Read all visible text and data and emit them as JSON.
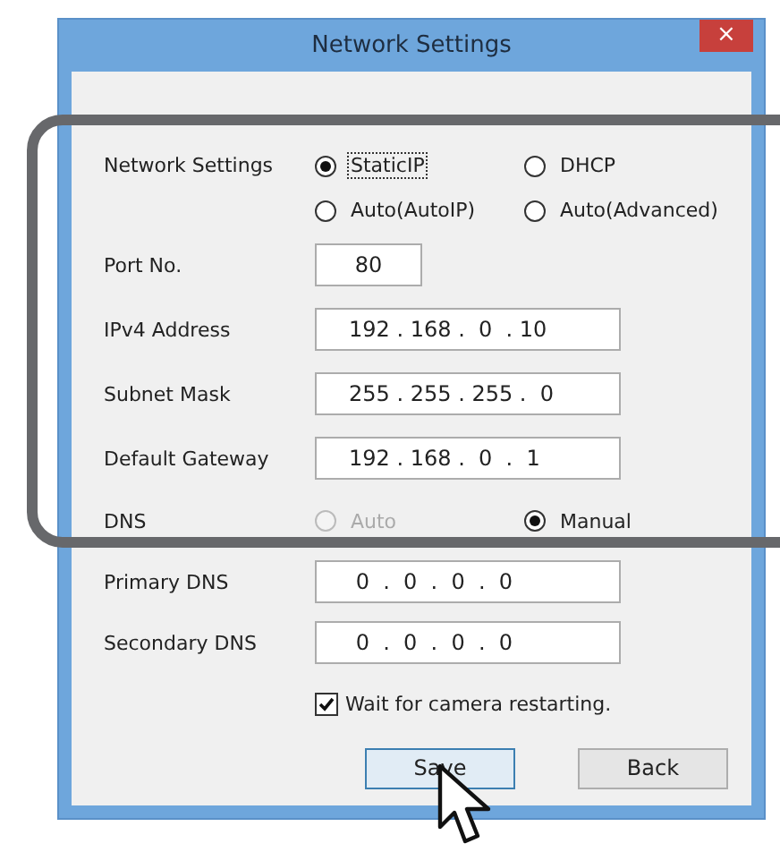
{
  "window": {
    "title": "Network Settings",
    "close": "×"
  },
  "network_settings": {
    "label": "Network Settings",
    "options": [
      {
        "label": "StaticIP",
        "selected": true,
        "focused": true
      },
      {
        "label": "DHCP",
        "selected": false,
        "focused": false
      },
      {
        "label": "Auto(AutoIP)",
        "selected": false,
        "focused": false
      },
      {
        "label": "Auto(Advanced)",
        "selected": false,
        "focused": false
      }
    ]
  },
  "fields": [
    {
      "label": "Port No.",
      "value": "80",
      "kind": "short"
    },
    {
      "label": "IPv4 Address",
      "value": "192 . 168 .  0  . 10",
      "kind": "ip"
    },
    {
      "label": "Subnet Mask",
      "value": "255 . 255 . 255 .  0",
      "kind": "ip"
    }
  ],
  "gateway": {
    "label": "Default Gateway",
    "value": "192 . 168 .  0  .  1"
  },
  "dns": {
    "label": "DNS",
    "options": [
      {
        "label": "Auto",
        "selected": false,
        "disabled": true
      },
      {
        "label": "Manual",
        "selected": true,
        "disabled": false
      }
    ]
  },
  "dns_fields": [
    {
      "label": "Primary DNS",
      "value": " 0  .  0  .  0  .  0"
    },
    {
      "label": "Secondary DNS",
      "value": " 0  .  0  .  0  .  0"
    }
  ],
  "wait_checkbox": {
    "label": "Wait for camera restarting.",
    "checked": true
  },
  "buttons": [
    {
      "label": "Save",
      "focused": true
    },
    {
      "label": "Back",
      "focused": false
    }
  ]
}
